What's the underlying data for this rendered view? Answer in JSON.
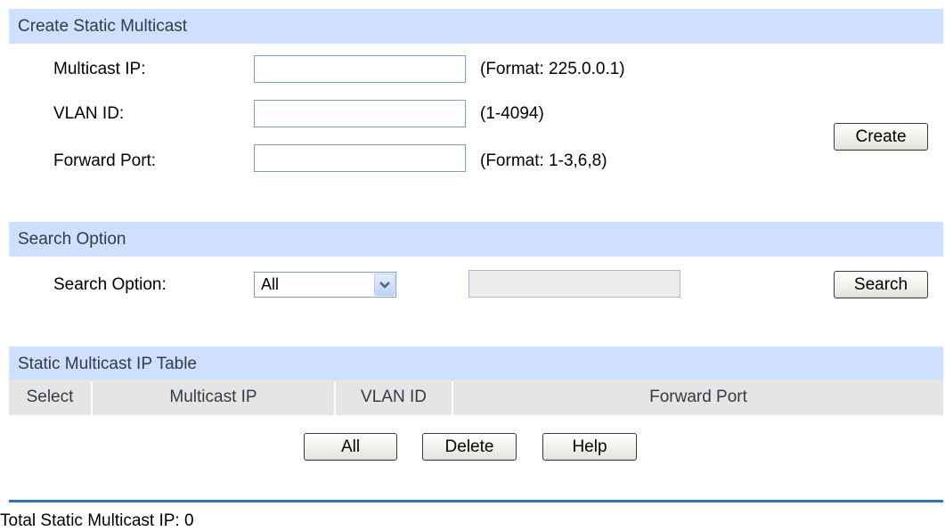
{
  "create": {
    "header": "Create Static Multicast",
    "multicast_ip_label": "Multicast IP:",
    "multicast_ip_value": "",
    "multicast_ip_hint": "(Format: 225.0.0.1)",
    "vlan_id_label": "VLAN ID:",
    "vlan_id_value": "",
    "vlan_id_hint": "(1-4094)",
    "forward_port_label": "Forward Port:",
    "forward_port_value": "",
    "forward_port_hint": "(Format: 1-3,6,8)",
    "create_button": "Create"
  },
  "search": {
    "header": "Search Option",
    "label": "Search Option:",
    "selected": "All",
    "value": "",
    "search_button": "Search"
  },
  "table": {
    "header": "Static Multicast IP Table",
    "columns": [
      "Select",
      "Multicast IP",
      "VLAN ID",
      "Forward Port"
    ],
    "rows": [],
    "all_button": "All",
    "delete_button": "Delete",
    "help_button": "Help"
  },
  "footer": {
    "total": "Total Static Multicast IP: 0"
  },
  "colors": {
    "section_header_bg": "#cfe0ff",
    "table_header_bg": "#e5e5e5",
    "divider": "#2d73b8"
  },
  "icons": {
    "select_arrow": "chevron-down-icon"
  }
}
